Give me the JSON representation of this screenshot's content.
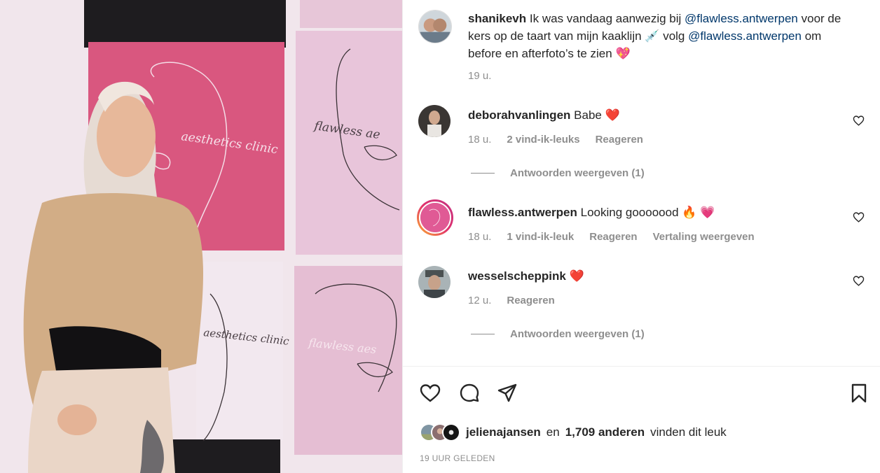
{
  "post": {
    "author": "shanikevh",
    "caption_text_1": "Ik was vandaag aanwezig bij",
    "mention_1": "@flawless.antwerpen",
    "caption_text_2": "voor de kers op de taart van mijn kaaklijn",
    "caption_emoji_1": "💉",
    "caption_text_3": "volg",
    "mention_2": "@flawless.antwerpen",
    "caption_text_4": "om before en afterfoto’s te zien",
    "caption_emoji_2": "💖",
    "time": "19 u."
  },
  "photo": {
    "sign_text_1": "aesthetics clinic",
    "sign_text_2": "flawless ae",
    "sign_text_3": "aesthetics clinic",
    "sign_text_4": "flawless aes"
  },
  "comments": [
    {
      "user": "deborahvanlingen",
      "text": "Babe",
      "emoji": "❤️",
      "time": "18 u.",
      "likes": "2 vind-ik-leuks",
      "reply": "Reageren",
      "replies": "Antwoorden weergeven (1)"
    },
    {
      "user": "flawless.antwerpen",
      "text": "Looking gooooood",
      "emoji": "🔥 💗",
      "time": "18 u.",
      "likes": "1 vind-ik-leuk",
      "reply": "Reageren",
      "translate": "Vertaling weergeven"
    },
    {
      "user": "wesselscheppink",
      "text": "",
      "emoji": "❤️",
      "time": "12 u.",
      "reply": "Reageren",
      "replies": "Antwoorden weergeven (1)"
    }
  ],
  "likes": {
    "first_user": "jelienajansen",
    "connector": "en",
    "count": "1,709 anderen",
    "suffix": "vinden dit leuk"
  },
  "timestamp": "19 UUR GELEDEN",
  "colors": {
    "text": "#262626",
    "secondary": "#8e8e8e",
    "link": "#00376b",
    "heart": "#ed4956",
    "pink_panel": "#d8567f",
    "light_pink": "#e6c4d6"
  }
}
